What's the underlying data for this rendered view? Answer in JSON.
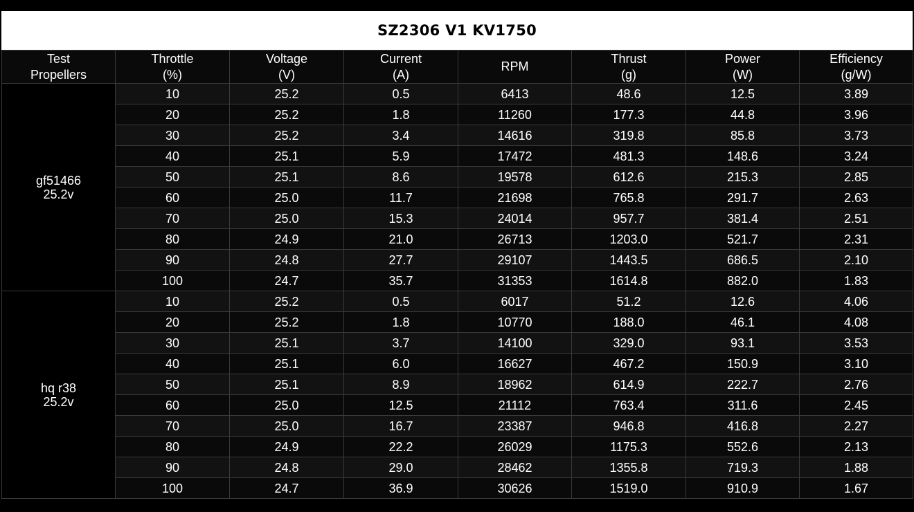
{
  "title": "SZ2306 V1 KV1750",
  "header": {
    "propellers": [
      "Test",
      "Propellers"
    ],
    "throttle": [
      "Throttle",
      "(%)"
    ],
    "voltage": [
      "Voltage",
      "(V)"
    ],
    "current": [
      "Current",
      "(A)"
    ],
    "rpm": [
      "RPM"
    ],
    "thrust": [
      "Thrust",
      "(g)"
    ],
    "power": [
      "Power",
      "(W)"
    ],
    "efficiency": [
      "Efficiency",
      "(g/W)"
    ]
  },
  "groups": [
    {
      "propeller": [
        "gf51466",
        "25.2v"
      ],
      "rows": [
        [
          "10",
          "25.2",
          "0.5",
          "6413",
          "48.6",
          "12.5",
          "3.89"
        ],
        [
          "20",
          "25.2",
          "1.8",
          "11260",
          "177.3",
          "44.8",
          "3.96"
        ],
        [
          "30",
          "25.2",
          "3.4",
          "14616",
          "319.8",
          "85.8",
          "3.73"
        ],
        [
          "40",
          "25.1",
          "5.9",
          "17472",
          "481.3",
          "148.6",
          "3.24"
        ],
        [
          "50",
          "25.1",
          "8.6",
          "19578",
          "612.6",
          "215.3",
          "2.85"
        ],
        [
          "60",
          "25.0",
          "11.7",
          "21698",
          "765.8",
          "291.7",
          "2.63"
        ],
        [
          "70",
          "25.0",
          "15.3",
          "24014",
          "957.7",
          "381.4",
          "2.51"
        ],
        [
          "80",
          "24.9",
          "21.0",
          "26713",
          "1203.0",
          "521.7",
          "2.31"
        ],
        [
          "90",
          "24.8",
          "27.7",
          "29107",
          "1443.5",
          "686.5",
          "2.10"
        ],
        [
          "100",
          "24.7",
          "35.7",
          "31353",
          "1614.8",
          "882.0",
          "1.83"
        ]
      ]
    },
    {
      "propeller": [
        "hq r38",
        "25.2v"
      ],
      "rows": [
        [
          "10",
          "25.2",
          "0.5",
          "6017",
          "51.2",
          "12.6",
          "4.06"
        ],
        [
          "20",
          "25.2",
          "1.8",
          "10770",
          "188.0",
          "46.1",
          "4.08"
        ],
        [
          "30",
          "25.1",
          "3.7",
          "14100",
          "329.0",
          "93.1",
          "3.53"
        ],
        [
          "40",
          "25.1",
          "6.0",
          "16627",
          "467.2",
          "150.9",
          "3.10"
        ],
        [
          "50",
          "25.1",
          "8.9",
          "18962",
          "614.9",
          "222.7",
          "2.76"
        ],
        [
          "60",
          "25.0",
          "12.5",
          "21112",
          "763.4",
          "311.6",
          "2.45"
        ],
        [
          "70",
          "25.0",
          "16.7",
          "23387",
          "946.8",
          "416.8",
          "2.27"
        ],
        [
          "80",
          "24.9",
          "22.2",
          "26029",
          "1175.3",
          "552.6",
          "2.13"
        ],
        [
          "90",
          "24.8",
          "29.0",
          "28462",
          "1355.8",
          "719.3",
          "1.88"
        ],
        [
          "100",
          "24.7",
          "36.9",
          "30626",
          "1519.0",
          "910.9",
          "1.67"
        ]
      ]
    }
  ]
}
